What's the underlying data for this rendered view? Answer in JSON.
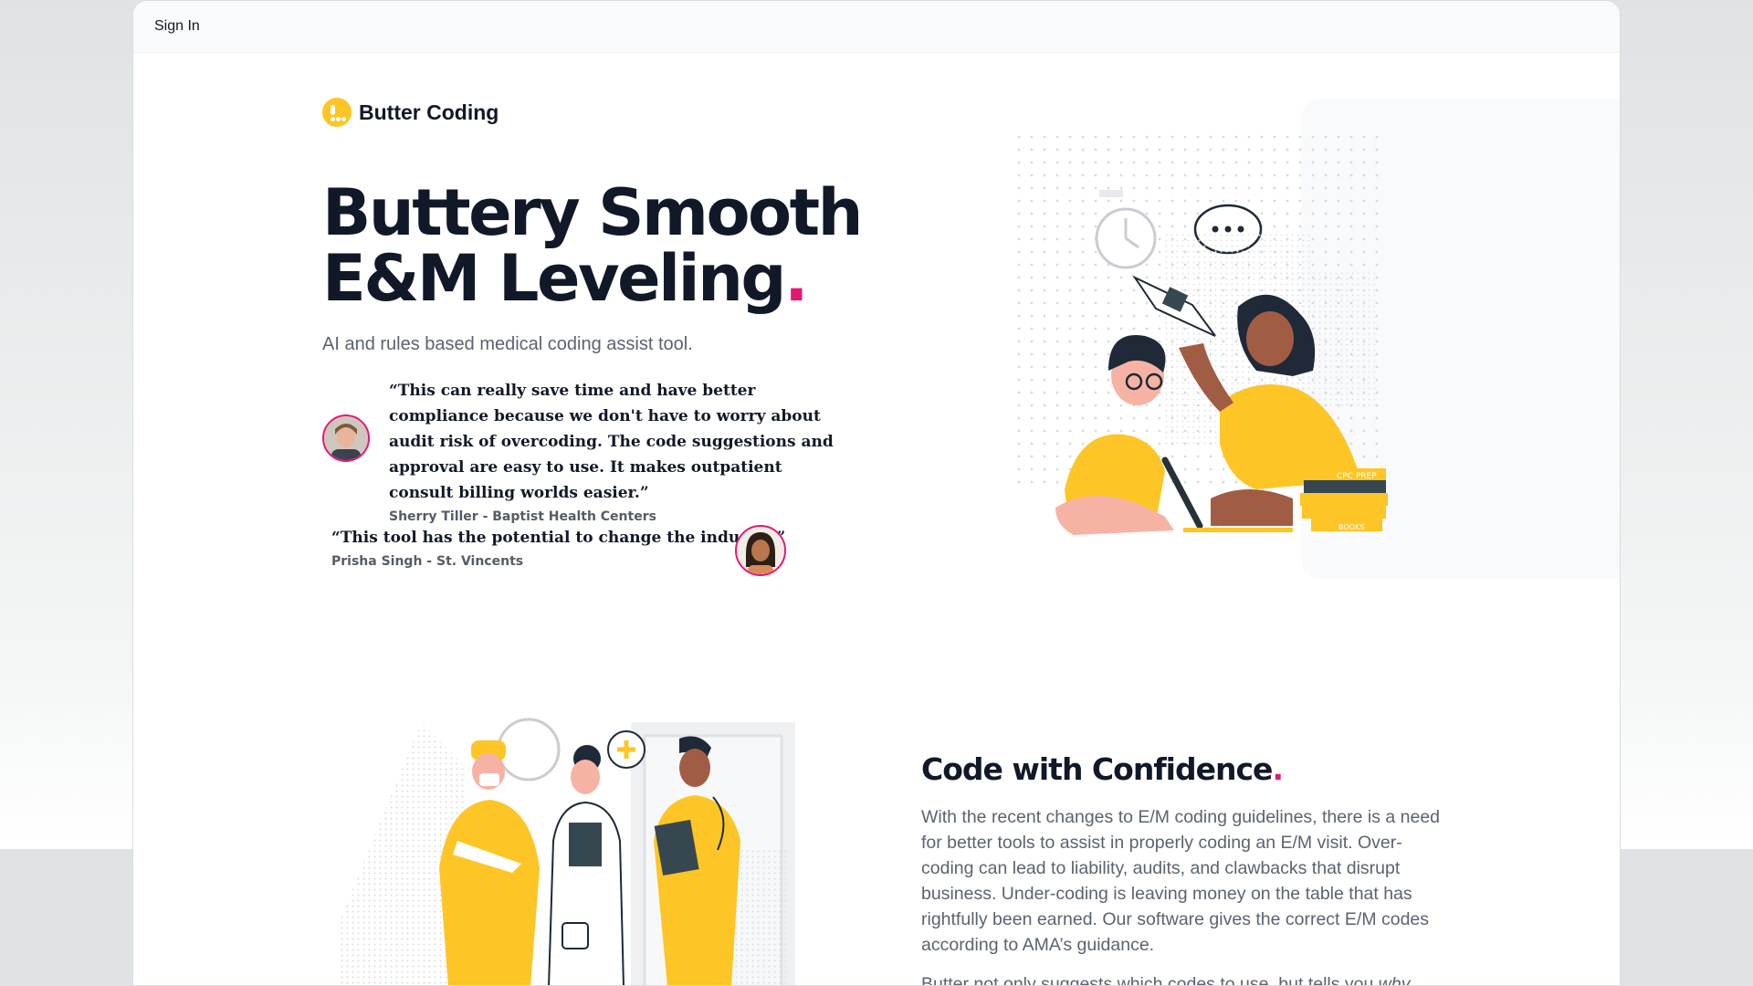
{
  "topbar": {
    "sign_in_label": "Sign In"
  },
  "brand": {
    "name": "Butter Coding",
    "accent": "#fdc526",
    "highlight": "#e6176f"
  },
  "hero": {
    "title_line1": "Buttery Smooth",
    "title_line2": "E&M Leveling",
    "title_punct": ".",
    "subtitle": "AI and rules based medical coding assist tool."
  },
  "testimonials": [
    {
      "quote": "“This can really save time and have better compliance because we don't have to worry about audit risk of overcoding. The code suggestions and approval are easy to use. It makes outpatient consult billing worlds easier.”",
      "author": "Sherry Tiller - Baptist Health Centers"
    },
    {
      "quote": "“This tool has the potential to change the industry.”",
      "author": "Prisha Singh - St. Vincents"
    }
  ],
  "illustration": {
    "book_label_1": "CPC PREP",
    "book_label_2": "BOOKS"
  },
  "section2": {
    "title": "Code with Confidence",
    "title_punct": ".",
    "body": "With the recent changes to E/M coding guidelines, there is a need for better tools to assist in properly coding an E/M visit. Over-coding can lead to liability, audits, and clawbacks that disrupt business. Under-coding is leaving money on the table that has rightfully been earned. Our software gives the correct E/M codes according to AMA’s guidance.",
    "body2_start": "Butter not only suggests which codes to use, but tells you ",
    "body2_em": "why"
  }
}
